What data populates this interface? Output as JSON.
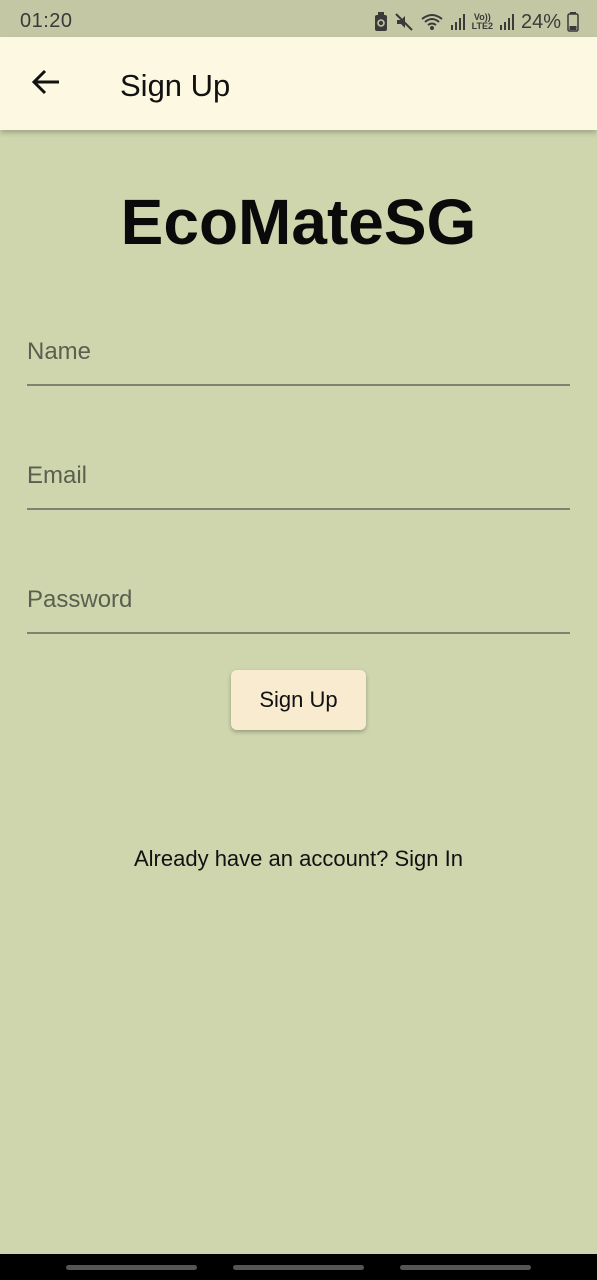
{
  "status_bar": {
    "time": "01:20",
    "battery_percent": "24%",
    "network_label_top": "Vo))",
    "network_label_bottom": "LTE2",
    "icons": [
      "battery-saver-icon",
      "mute-icon",
      "wifi-icon",
      "signal-icon",
      "signal-icon",
      "battery-icon"
    ]
  },
  "app_bar": {
    "back_icon": "arrow-left-icon",
    "title": "Sign Up"
  },
  "main": {
    "logo_text": "EcoMateSG",
    "fields": {
      "name": {
        "placeholder": "Name",
        "value": ""
      },
      "email": {
        "placeholder": "Email",
        "value": ""
      },
      "password": {
        "placeholder": "Password",
        "value": ""
      }
    },
    "signup_button_label": "Sign Up",
    "signin_link_text": "Already have an account? Sign In"
  },
  "colors": {
    "background": "#cfd6ae",
    "app_bar": "#fdf8e1",
    "button": "#f9ebd0",
    "status_bar": "#c3c7a4"
  }
}
